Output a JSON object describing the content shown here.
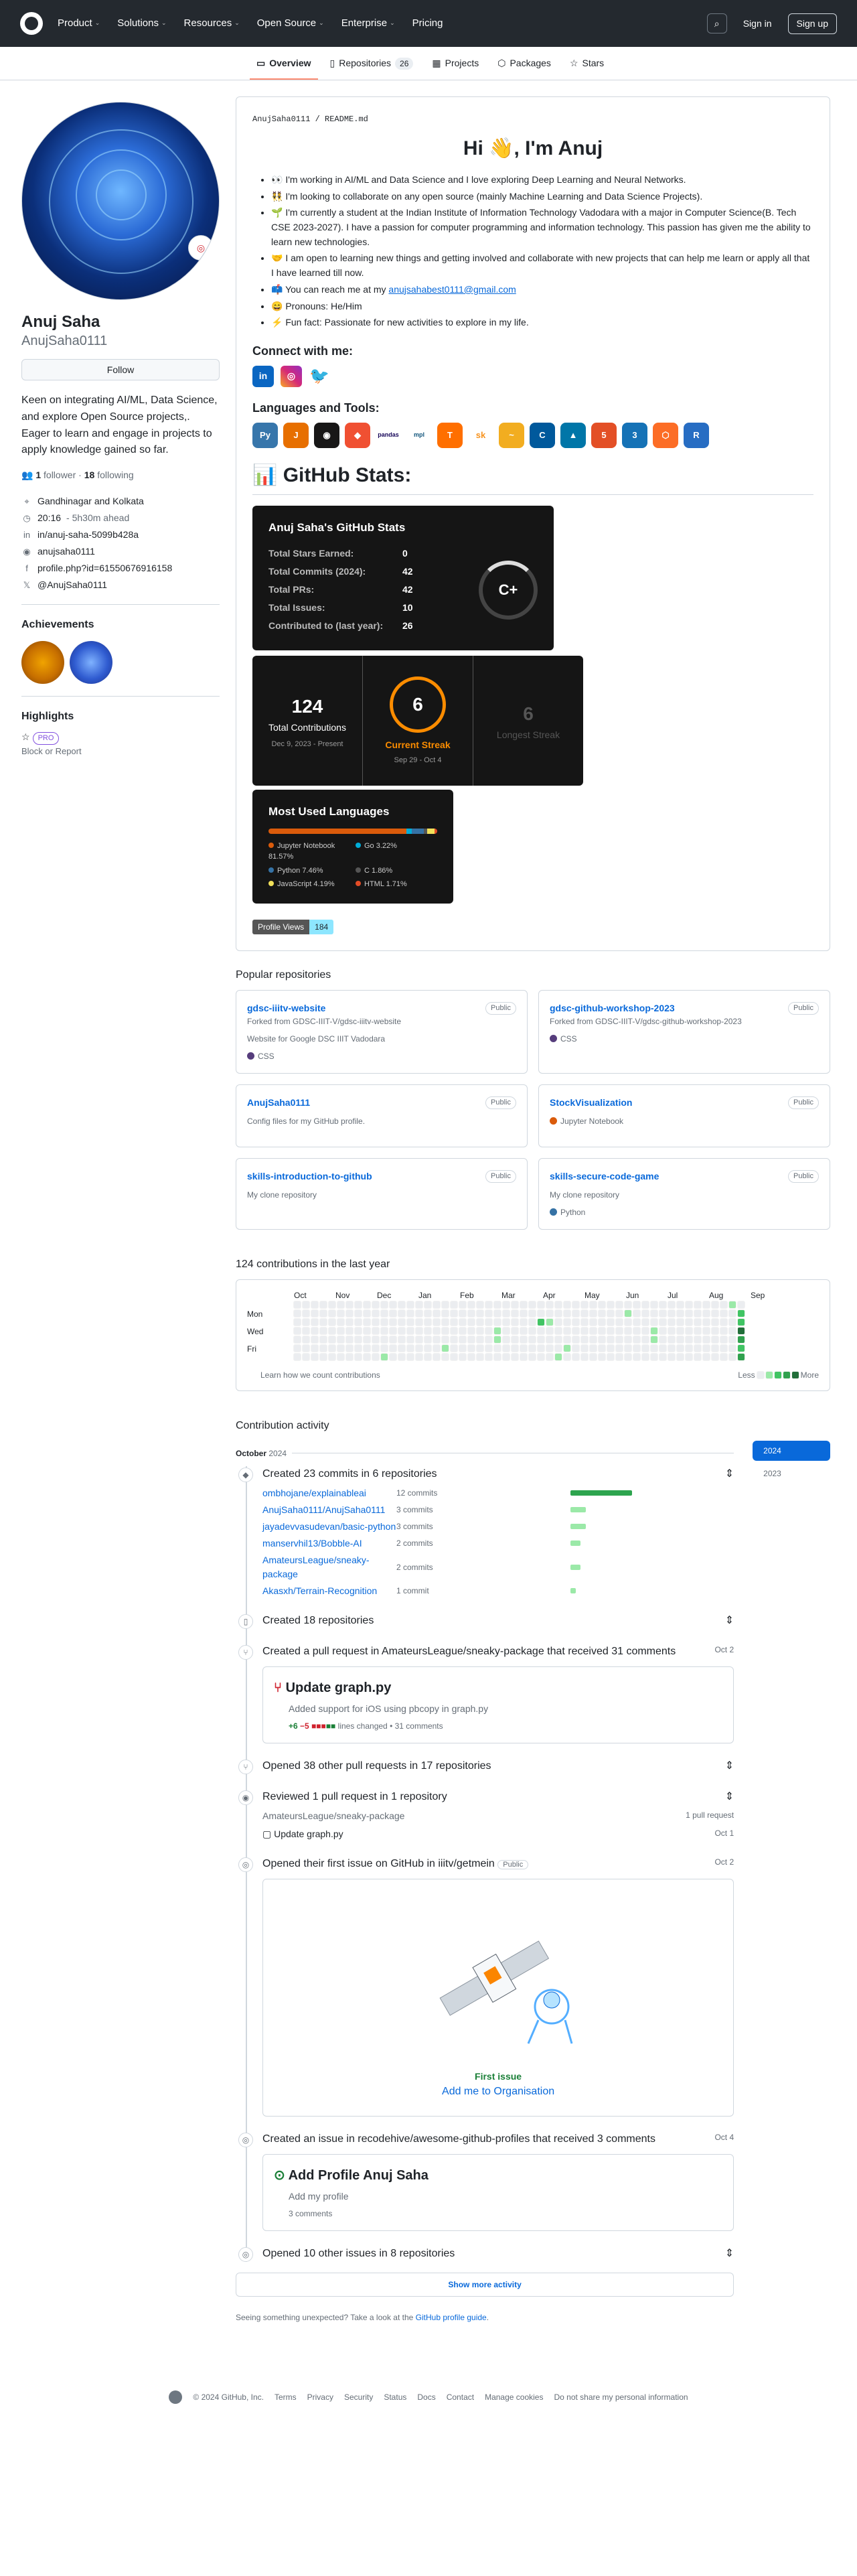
{
  "header": {
    "nav": [
      "Product",
      "Solutions",
      "Resources",
      "Open Source",
      "Enterprise",
      "Pricing"
    ],
    "signin": "Sign in",
    "signup": "Sign up"
  },
  "tabs": [
    {
      "label": "Overview"
    },
    {
      "label": "Repositories",
      "count": "26"
    },
    {
      "label": "Projects"
    },
    {
      "label": "Packages"
    },
    {
      "label": "Stars"
    }
  ],
  "profile": {
    "name": "Anuj Saha",
    "login": "AnujSaha0111",
    "follow": "Follow",
    "bio": "Keen on integrating AI/ML, Data Science, and explore Open Source projects,. Eager to learn and engage in projects to apply knowledge gained so far.",
    "followers": "1",
    "followers_label": "follower",
    "following": "18",
    "following_label": "following",
    "location": "Gandhinagar and Kolkata",
    "time": "20:16",
    "time_note": "- 5h30m ahead",
    "linkedin": "in/anuj-saha-5099b428a",
    "instagram": "anujsaha0111",
    "facebook": "profile.php?id=61550676916158",
    "x": "@AnujSaha0111",
    "achievements": "Achievements",
    "highlights": "Highlights",
    "pro": "PRO",
    "block": "Block or Report"
  },
  "readme": {
    "path_user": "AnujSaha0111",
    "path_file": "README.md",
    "title": "Hi 👋, I'm Anuj",
    "bullets": [
      "👀 I'm working in AI/ML and Data Science and I love exploring Deep Learning and Neural Networks.",
      "👯 I'm looking to collaborate on any open source (mainly Machine Learning and Data Science Projects).",
      "🌱 I'm currently a student at the Indian Institute of Information Technology Vadodara with a major in Computer Science(B. Tech CSE 2023-2027). I have a passion for computer programming and information technology. This passion has given me the ability to learn new technologies.",
      "🤝 I am open to learning new things and getting involved and collaborate with new projects that can help me learn or apply all that I have learned till now."
    ],
    "email_prefix": "📫 You can reach me at my ",
    "email": "anujsahabest0111@gmail.com",
    "pronouns": "😄 Pronouns: He/Him",
    "funfact": "⚡ Fun fact: Passionate for new activities to explore in my life.",
    "connect": "Connect with me:",
    "tools": "Languages and Tools:",
    "stats_title": "📊 GitHub Stats:"
  },
  "stats": {
    "title": "Anuj Saha's GitHub Stats",
    "rows": [
      {
        "k": "Total Stars Earned:",
        "v": "0"
      },
      {
        "k": "Total Commits (2024):",
        "v": "42"
      },
      {
        "k": "Total PRs:",
        "v": "42"
      },
      {
        "k": "Total Issues:",
        "v": "10"
      },
      {
        "k": "Contributed to (last year):",
        "v": "26"
      }
    ],
    "grade": "C+"
  },
  "streak": {
    "total": "124",
    "total_label": "Total Contributions",
    "total_range": "Dec 9, 2023 - Present",
    "current": "6",
    "current_label": "Current Streak",
    "current_range": "Sep 29 - Oct 4",
    "longest": "6",
    "longest_label": "Longest Streak"
  },
  "langs": {
    "title": "Most Used Languages",
    "items": [
      {
        "n": "Jupyter Notebook",
        "p": "81.57%",
        "c": "#DA5B0B",
        "w": 81.57
      },
      {
        "n": "Go",
        "p": "3.22%",
        "c": "#00ADD8",
        "w": 3.22
      },
      {
        "n": "Python",
        "p": "7.46%",
        "c": "#3572A5",
        "w": 7.46
      },
      {
        "n": "C",
        "p": "1.86%",
        "c": "#555555",
        "w": 1.86
      },
      {
        "n": "JavaScript",
        "p": "4.19%",
        "c": "#f1e05a",
        "w": 4.19
      },
      {
        "n": "HTML",
        "p": "1.71%",
        "c": "#e34c26",
        "w": 1.71
      }
    ]
  },
  "views": {
    "label": "Profile Views",
    "value": "184"
  },
  "popular": {
    "title": "Popular repositories",
    "public": "Public",
    "repos": [
      {
        "name": "gdsc-iiitv-website",
        "fork": "Forked from GDSC-IIIT-V/gdsc-iiitv-website",
        "desc": "Website for Google DSC IIIT Vadodara",
        "lang": "CSS",
        "color": "#563d7c"
      },
      {
        "name": "gdsc-github-workshop-2023",
        "fork": "Forked from GDSC-IIIT-V/gdsc-github-workshop-2023",
        "desc": "",
        "lang": "CSS",
        "color": "#563d7c"
      },
      {
        "name": "AnujSaha0111",
        "fork": "",
        "desc": "Config files for my GitHub profile.",
        "lang": "",
        "color": ""
      },
      {
        "name": "StockVisualization",
        "fork": "",
        "desc": "",
        "lang": "Jupyter Notebook",
        "color": "#DA5B0B"
      },
      {
        "name": "skills-introduction-to-github",
        "fork": "",
        "desc": "My clone repository",
        "lang": "",
        "color": ""
      },
      {
        "name": "skills-secure-code-game",
        "fork": "",
        "desc": "My clone repository",
        "lang": "Python",
        "color": "#3572A5"
      }
    ]
  },
  "calendar": {
    "title": "124 contributions in the last year",
    "months": [
      "Oct",
      "Nov",
      "Dec",
      "Jan",
      "Feb",
      "Mar",
      "Apr",
      "May",
      "Jun",
      "Jul",
      "Aug",
      "Sep"
    ],
    "days": [
      "",
      "Mon",
      "",
      "Wed",
      "",
      "Fri",
      ""
    ],
    "learn": "Learn how we count contributions",
    "less": "Less",
    "more": "More"
  },
  "activity": {
    "title": "Contribution activity",
    "month": "October",
    "year": "2024",
    "years": [
      "2024",
      "2023"
    ],
    "commits_head": "Created 23 commits in 6 repositories",
    "commits": [
      {
        "repo": "ombhojane/explainableai",
        "n": "12 commits",
        "v": 12
      },
      {
        "repo": "AnujSaha0111/AnujSaha0111",
        "n": "3 commits",
        "v": 3
      },
      {
        "repo": "jayadevvasudevan/basic-python",
        "n": "3 commits",
        "v": 3
      },
      {
        "repo": "manservhil13/Bobble-AI",
        "n": "2 commits",
        "v": 2
      },
      {
        "repo": "AmateursLeague/sneaky-package",
        "n": "2 commits",
        "v": 2
      },
      {
        "repo": "Akasxh/Terrain-Recognition",
        "n": "1 commit",
        "v": 1
      }
    ],
    "repos_created": "Created 18 repositories",
    "pr_head": "Created a pull request in AmateursLeague/sneaky-package that received 31 comments",
    "pr_date": "Oct 2",
    "pr_title": "Update graph.py",
    "pr_body": "Added support for iOS using pbcopy in graph.py",
    "pr_add": "+6",
    "pr_del": "−5",
    "pr_lines": "lines changed",
    "pr_comments": "• 31 comments",
    "opened_prs": "Opened 38 other pull requests in 17 repositories",
    "reviewed": "Reviewed 1 pull request in 1 repository",
    "reviewed_repo": "AmateursLeague/sneaky-package",
    "reviewed_count": "1 pull request",
    "reviewed_pr": "Update graph.py",
    "reviewed_date": "Oct 1",
    "first_issue": "Opened their first issue on GitHub in iiitv/getmein",
    "first_issue_date": "Oct 2",
    "first_label": "First issue",
    "first_link": "Add me to Organisation",
    "issue_head": "Created an issue in recodehive/awesome-github-profiles that received 3 comments",
    "issue_date": "Oct 4",
    "issue_title": "Add Profile Anuj Saha",
    "issue_body": "Add my profile",
    "issue_comments": "3 comments",
    "other_issues": "Opened 10 other issues in 8 repositories",
    "more": "Show more activity",
    "hint_prefix": "Seeing something unexpected? Take a look at the ",
    "hint_link": "GitHub profile guide",
    "hint_suffix": "."
  },
  "footer": {
    "copy": "© 2024 GitHub, Inc.",
    "links": [
      "Terms",
      "Privacy",
      "Security",
      "Status",
      "Docs",
      "Contact",
      "Manage cookies",
      "Do not share my personal information"
    ]
  }
}
